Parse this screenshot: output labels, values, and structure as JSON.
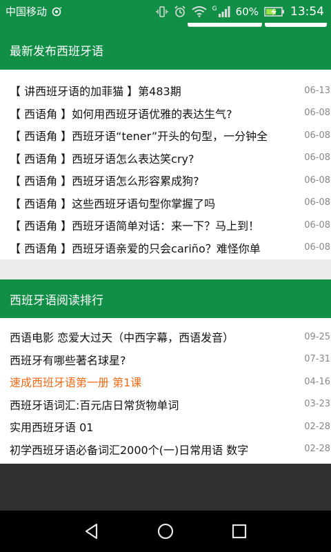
{
  "status_bar": {
    "carrier": "中国移动",
    "network": "G",
    "battery": "60%",
    "time": "13:54",
    "icons": [
      "hd-call-icon",
      "vibrate-icon",
      "alarm-icon",
      "wifi-icon",
      "signal-icon",
      "battery-charging-icon"
    ]
  },
  "latest": {
    "header": "最新发布西班牙语",
    "items": [
      {
        "title": "【 讲西班牙语的加菲猫 】第483期",
        "date": "06-13"
      },
      {
        "title": "【 西语角 】如何用西班牙语优雅的表达生气?",
        "date": "06-08"
      },
      {
        "title": "【 西语角 】西班牙语“tener”开头的句型，一分钟全",
        "date": "06-08"
      },
      {
        "title": "【 西语角 】西班牙语怎么表达笑cry?",
        "date": "06-08"
      },
      {
        "title": "【 西语角 】西班牙语怎么形容累成狗?",
        "date": "06-08"
      },
      {
        "title": "【 西语角 】这些西班牙语句型你掌握了吗",
        "date": "06-08"
      },
      {
        "title": "【 西语角 】西班牙语简单对话：来一下？马上到！",
        "date": "06-08"
      },
      {
        "title": "【 西语角 】西班牙语亲爱的只会cariño？难怪你单",
        "date": "06-08"
      }
    ]
  },
  "ranking": {
    "header": "西班牙语阅读排行",
    "items": [
      {
        "title": "西语电影 恋爱大过天（中西字幕，西语发音）",
        "date": "09-25",
        "highlight": false
      },
      {
        "title": "西班牙有哪些著名球星?",
        "date": "07-31",
        "highlight": false
      },
      {
        "title": "速成西班牙语第一册 第1课",
        "date": "04-16",
        "highlight": true
      },
      {
        "title": "西班牙语词汇:百元店日常货物单词",
        "date": "03-23",
        "highlight": false
      },
      {
        "title": "实用西班牙语 01",
        "date": "02-28",
        "highlight": false
      },
      {
        "title": "初学西班牙语必备词汇2000个(一)日常用语 数字",
        "date": "02-28",
        "highlight": false
      }
    ]
  },
  "nav": {
    "icons": [
      "back-icon",
      "home-icon",
      "recents-icon"
    ]
  },
  "colors": {
    "brand_green": "#128f47",
    "highlight_orange": "#f06a14",
    "date_gray": "#888888"
  }
}
